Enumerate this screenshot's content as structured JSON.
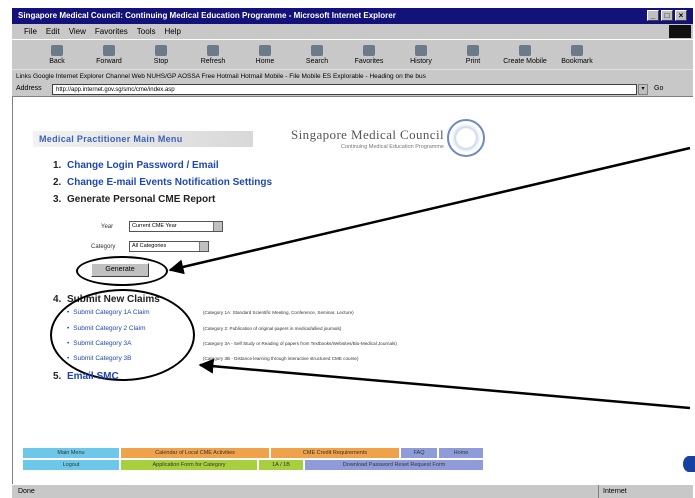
{
  "window": {
    "title": "Singapore Medical Council: Continuing Medical Education Programme - Microsoft Internet Explorer",
    "buttons": [
      "_",
      "□",
      "×"
    ]
  },
  "menubar": [
    "File",
    "Edit",
    "View",
    "Favorites",
    "Tools",
    "Help"
  ],
  "toolbar": [
    "Back",
    "Forward",
    "Stop",
    "Refresh",
    "Home",
    "Search",
    "Favorites",
    "History",
    "Print",
    "Create Mobile",
    "Bookmark"
  ],
  "links_bar": "Links  Google  Internet Explorer  Channel Web  NUHS/GP  AOSSA  Free Hotmail  Hotmail  Mobile - File Mobile ES  Explorable - Heading on the bus",
  "address": {
    "label": "Address",
    "url": "http://app.internet.gov.sg/smc/cme/index.asp",
    "go": "Go"
  },
  "page": {
    "menu_title": "Medical Practitioner Main Menu",
    "smc_name": "Singapore Medical Council",
    "smc_sub": "Continuing Medical Education Programme",
    "items": [
      {
        "num": "1.",
        "text": "Change Login Password / Email"
      },
      {
        "num": "2.",
        "text": "Change E-mail Events Notification Settings"
      },
      {
        "num": "3.",
        "text": "Generate Personal CME Report"
      },
      {
        "num": "4.",
        "text": "Submit New Claims"
      },
      {
        "num": "5.",
        "text": "Email SMC"
      }
    ],
    "year_label": "Year",
    "year_value": "Current CME Year",
    "category_label": "Category",
    "category_value": "All Categories",
    "generate_button": "Generate",
    "categories": [
      {
        "label": "Submit Category 1A Claim",
        "desc": "(Category 1A: Standard Scientific Meeting, Conference, Seminar, Lecture)"
      },
      {
        "label": "Submit Category 2 Claim",
        "desc": "(Category 2: Publication of original papers in medical/allied journals)"
      },
      {
        "label": "Submit Category 3A",
        "desc": "(Category 3A - Self Study or Reading of papers from Textbooks/Websites/Bio-Medical Journals)"
      },
      {
        "label": "Submit Category 3B",
        "desc": "(Category 3B - Distance learning through interactive structured CME course)"
      }
    ],
    "footer_nav": [
      {
        "text": "Main Menu",
        "color": "#6cc7e8"
      },
      {
        "text": "Calendar of Local CME Activities",
        "color": "#f0a24a"
      },
      {
        "text": "CME Credit Requirements",
        "color": "#f0a24a"
      },
      {
        "text": "FAQ",
        "color": "#8f9cd9"
      },
      {
        "text": "Home",
        "color": "#8f9cd9"
      },
      {
        "text": "Logout",
        "color": "#6cc7e8"
      },
      {
        "text": "Application Form for Category",
        "color": "#a7cf3e"
      },
      {
        "text": "1A / 1B",
        "color": "#a7cf3e"
      },
      {
        "text": "Download Password Reset Request Form",
        "color": "#8f9cd9"
      }
    ]
  },
  "statusbar": {
    "left": "Done",
    "zone": "Internet"
  }
}
